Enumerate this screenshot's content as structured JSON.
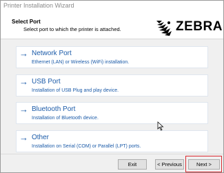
{
  "window": {
    "title": "Printer Installation Wizard"
  },
  "header": {
    "title": "Select Port",
    "subtitle": "Select port to which the printer is attached.",
    "logo_text": "ZEBRA"
  },
  "options": [
    {
      "arrow": "→",
      "label": "Network Port",
      "description": "Ethernet (LAN) or Wireless (WiFi) installation."
    },
    {
      "arrow": "→",
      "label": "USB Port",
      "description": "Installation of USB Plug and play device."
    },
    {
      "arrow": "→",
      "label": "Bluetooth Port",
      "description": "Installation of Bluetooth device."
    },
    {
      "arrow": "→",
      "label": "Other",
      "description": "Installation on Serial (COM) or Parallel (LPT) ports."
    }
  ],
  "buttons": {
    "exit": "Exit",
    "previous": "< Previous",
    "next": "Next >"
  },
  "colors": {
    "link": "#1a5aa8",
    "highlight": "#d9282f"
  }
}
